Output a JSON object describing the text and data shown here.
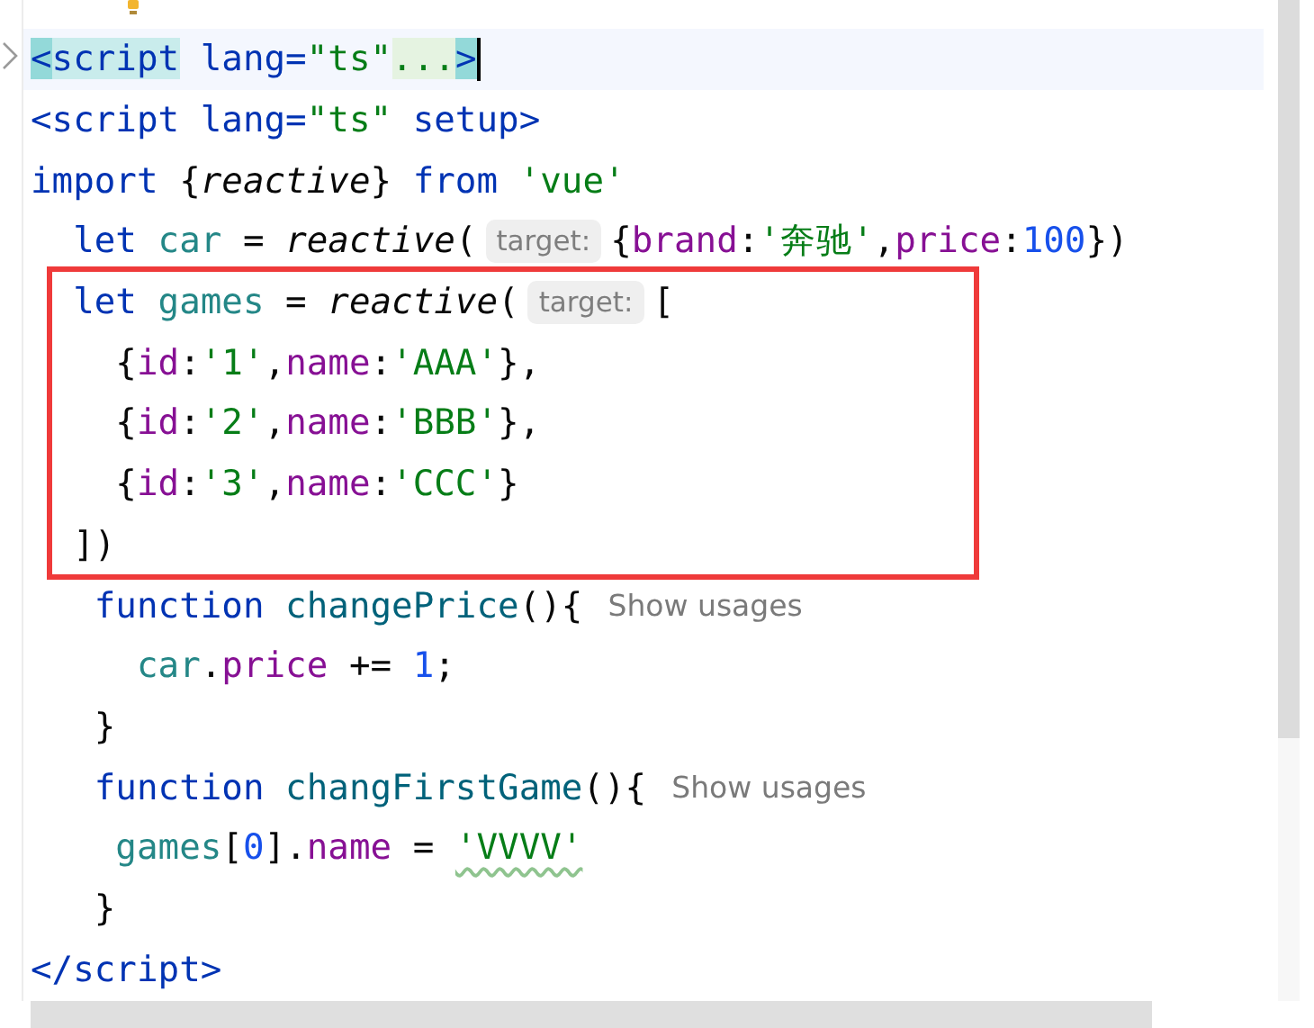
{
  "editor": {
    "blocks": [
      {
        "kind": "line",
        "current": true,
        "caret": true,
        "tokens": [
          {
            "text": "<",
            "kind": "brace_match"
          },
          {
            "text": "script",
            "kind": "tag_hl"
          },
          {
            "text": " lang=",
            "kind": "tag"
          },
          {
            "text": "\"ts\"",
            "kind": "string"
          },
          {
            "text": "...",
            "kind": "folded"
          },
          {
            "text": ">",
            "kind": "brace_match"
          }
        ]
      },
      {
        "kind": "line",
        "tokens": [
          {
            "text": "<script",
            "kind": "tag"
          },
          {
            "text": " lang=",
            "kind": "tag"
          },
          {
            "text": "\"ts\"",
            "kind": "string"
          },
          {
            "text": " setup>",
            "kind": "tag"
          }
        ]
      },
      {
        "kind": "line",
        "tokens": [
          {
            "text": "import",
            "kind": "keyword"
          },
          {
            "text": " {",
            "kind": "punct"
          },
          {
            "text": "reactive",
            "kind": "call"
          },
          {
            "text": "} ",
            "kind": "punct"
          },
          {
            "text": "from",
            "kind": "keyword"
          },
          {
            "text": " 'vue'",
            "kind": "string"
          }
        ]
      },
      {
        "kind": "line",
        "tokens": [
          {
            "text": "  let",
            "kind": "keyword"
          },
          {
            "text": " car",
            "kind": "local"
          },
          {
            "text": " = ",
            "kind": "punct"
          },
          {
            "text": "reactive",
            "kind": "call"
          },
          {
            "text": "(",
            "kind": "punct"
          },
          {
            "text": "target:",
            "kind": "hint"
          },
          {
            "text": "{",
            "kind": "punct"
          },
          {
            "text": "brand",
            "kind": "property"
          },
          {
            "text": ":",
            "kind": "punct"
          },
          {
            "text": "'奔驰'",
            "kind": "string"
          },
          {
            "text": ",",
            "kind": "punct"
          },
          {
            "text": "price",
            "kind": "property"
          },
          {
            "text": ":",
            "kind": "punct"
          },
          {
            "text": "100",
            "kind": "number"
          },
          {
            "text": "})",
            "kind": "punct"
          }
        ]
      },
      {
        "kind": "frame",
        "lines": [
          {
            "tokens": [
              {
                "text": "  let",
                "kind": "keyword"
              },
              {
                "text": " games",
                "kind": "local"
              },
              {
                "text": " = ",
                "kind": "punct"
              },
              {
                "text": "reactive",
                "kind": "call"
              },
              {
                "text": "(",
                "kind": "punct"
              },
              {
                "text": "target:",
                "kind": "hint"
              },
              {
                "text": "[",
                "kind": "punct"
              }
            ]
          },
          {
            "tokens": [
              {
                "text": "    {",
                "kind": "punct"
              },
              {
                "text": "id",
                "kind": "property"
              },
              {
                "text": ":",
                "kind": "punct"
              },
              {
                "text": "'1'",
                "kind": "string"
              },
              {
                "text": ",",
                "kind": "punct"
              },
              {
                "text": "name",
                "kind": "property"
              },
              {
                "text": ":",
                "kind": "punct"
              },
              {
                "text": "'AAA'",
                "kind": "string"
              },
              {
                "text": "},",
                "kind": "punct"
              }
            ]
          },
          {
            "tokens": [
              {
                "text": "    {",
                "kind": "punct"
              },
              {
                "text": "id",
                "kind": "property"
              },
              {
                "text": ":",
                "kind": "punct"
              },
              {
                "text": "'2'",
                "kind": "string"
              },
              {
                "text": ",",
                "kind": "punct"
              },
              {
                "text": "name",
                "kind": "property"
              },
              {
                "text": ":",
                "kind": "punct"
              },
              {
                "text": "'BBB'",
                "kind": "string"
              },
              {
                "text": "},",
                "kind": "punct"
              }
            ]
          },
          {
            "tokens": [
              {
                "text": "    {",
                "kind": "punct"
              },
              {
                "text": "id",
                "kind": "property"
              },
              {
                "text": ":",
                "kind": "punct"
              },
              {
                "text": "'3'",
                "kind": "string"
              },
              {
                "text": ",",
                "kind": "punct"
              },
              {
                "text": "name",
                "kind": "property"
              },
              {
                "text": ":",
                "kind": "punct"
              },
              {
                "text": "'CCC'",
                "kind": "string"
              },
              {
                "text": "}",
                "kind": "punct"
              }
            ]
          },
          {
            "tokens": [
              {
                "text": "  ])",
                "kind": "punct"
              }
            ]
          }
        ]
      },
      {
        "kind": "line",
        "tokens": [
          {
            "text": "   function",
            "kind": "keyword"
          },
          {
            "text": " changePrice",
            "kind": "funcname"
          },
          {
            "text": "(){",
            "kind": "punct"
          },
          {
            "text": "Show usages",
            "kind": "usage"
          }
        ]
      },
      {
        "kind": "line",
        "tokens": [
          {
            "text": "     car",
            "kind": "local"
          },
          {
            "text": ".",
            "kind": "punct"
          },
          {
            "text": "price",
            "kind": "property"
          },
          {
            "text": " += ",
            "kind": "punct"
          },
          {
            "text": "1",
            "kind": "number"
          },
          {
            "text": ";",
            "kind": "punct"
          }
        ]
      },
      {
        "kind": "line",
        "tokens": [
          {
            "text": "   }",
            "kind": "punct"
          }
        ]
      },
      {
        "kind": "line",
        "tokens": [
          {
            "text": "   function",
            "kind": "keyword"
          },
          {
            "text": " changFirstGame",
            "kind": "funcname"
          },
          {
            "text": "(){",
            "kind": "punct"
          },
          {
            "text": "Show usages",
            "kind": "usage"
          }
        ]
      },
      {
        "kind": "line",
        "tokens": [
          {
            "text": "    games",
            "kind": "local"
          },
          {
            "text": "[",
            "kind": "punct"
          },
          {
            "text": "0",
            "kind": "number"
          },
          {
            "text": "].",
            "kind": "punct"
          },
          {
            "text": "name",
            "kind": "property"
          },
          {
            "text": " = ",
            "kind": "punct"
          },
          {
            "text": "'VVVV'",
            "kind": "string_warn"
          }
        ]
      },
      {
        "kind": "line",
        "tokens": [
          {
            "text": "   }",
            "kind": "punct"
          }
        ]
      },
      {
        "kind": "line",
        "tokens": [
          {
            "text": "</script>",
            "kind": "tag"
          }
        ]
      }
    ]
  }
}
